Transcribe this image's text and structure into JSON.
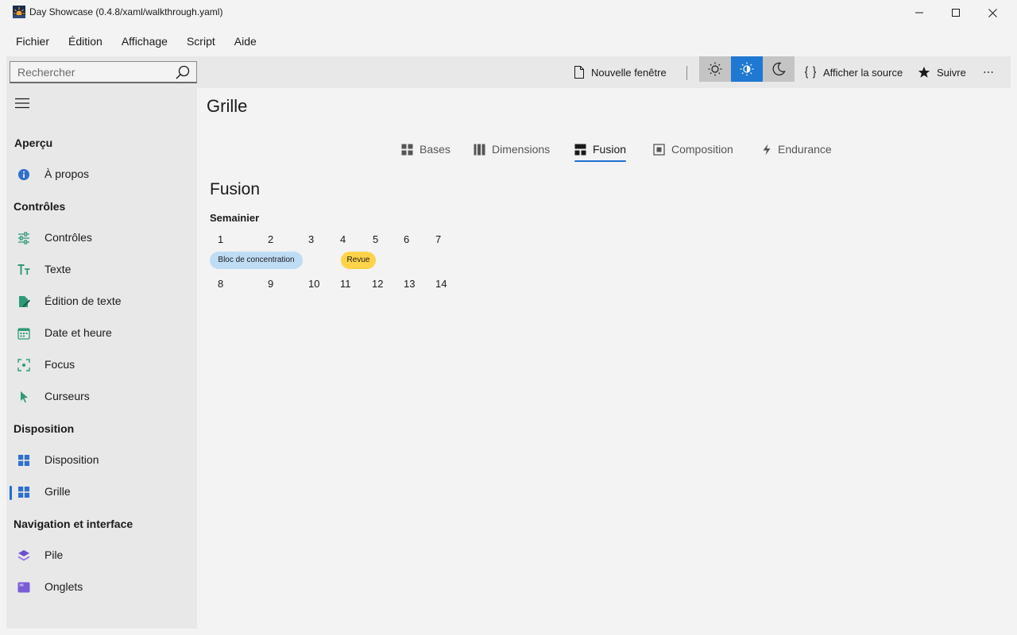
{
  "window": {
    "title": "Day Showcase (0.4.8/xaml/walkthrough.yaml)"
  },
  "menu": [
    "Fichier",
    "Édition",
    "Affichage",
    "Script",
    "Aide"
  ],
  "toolbar": {
    "search_placeholder": "Rechercher",
    "new_window_label": "Nouvelle fenêtre",
    "view_source_label": "Afficher la source",
    "follow_label": "Suivre",
    "active_theme": "auto"
  },
  "sidebar": {
    "sections": [
      {
        "title": "Aperçu",
        "items": [
          {
            "label": "À propos",
            "icon": "info-icon"
          }
        ]
      },
      {
        "title": "Contrôles",
        "items": [
          {
            "label": "Contrôles",
            "icon": "sliders-icon"
          },
          {
            "label": "Texte",
            "icon": "text-size-icon"
          },
          {
            "label": "Édition de texte",
            "icon": "edit-document-icon"
          },
          {
            "label": "Date et heure",
            "icon": "calendar-icon"
          },
          {
            "label": "Focus",
            "icon": "focus-icon"
          },
          {
            "label": "Curseurs",
            "icon": "cursor-icon"
          }
        ]
      },
      {
        "title": "Disposition",
        "items": [
          {
            "label": "Disposition",
            "icon": "grid-icon"
          },
          {
            "label": "Grille",
            "icon": "grid-icon",
            "selected": true
          }
        ]
      },
      {
        "title": "Navigation et interface",
        "items": [
          {
            "label": "Pile",
            "icon": "stack-icon"
          },
          {
            "label": "Onglets",
            "icon": "tabs-icon"
          }
        ]
      }
    ]
  },
  "main": {
    "page_title": "Grille",
    "tabs": [
      {
        "label": "Bases",
        "icon": "grid-icon"
      },
      {
        "label": "Dimensions",
        "icon": "columns-icon"
      },
      {
        "label": "Fusion",
        "icon": "merge-icon",
        "active": true
      },
      {
        "label": "Composition",
        "icon": "frame-icon"
      },
      {
        "label": "Endurance",
        "icon": "lightning-icon"
      }
    ],
    "section_title": "Fusion",
    "calendar": {
      "title": "Semainier",
      "week1": [
        "1",
        "2",
        "3",
        "4",
        "5",
        "6",
        "7"
      ],
      "week2": [
        "8",
        "9",
        "10",
        "11",
        "12",
        "13",
        "14"
      ],
      "events": [
        {
          "label": "Bloc de concentration",
          "color": "#bfdcf5"
        },
        {
          "label": "Revue",
          "color": "#ffd34a"
        }
      ]
    }
  },
  "colors": {
    "accent": "#1f6fd0",
    "sidebar_icon_green": "#2e9a78",
    "sidebar_icon_blue": "#2f6fcf",
    "sidebar_icon_purple": "#6a4fd0"
  }
}
